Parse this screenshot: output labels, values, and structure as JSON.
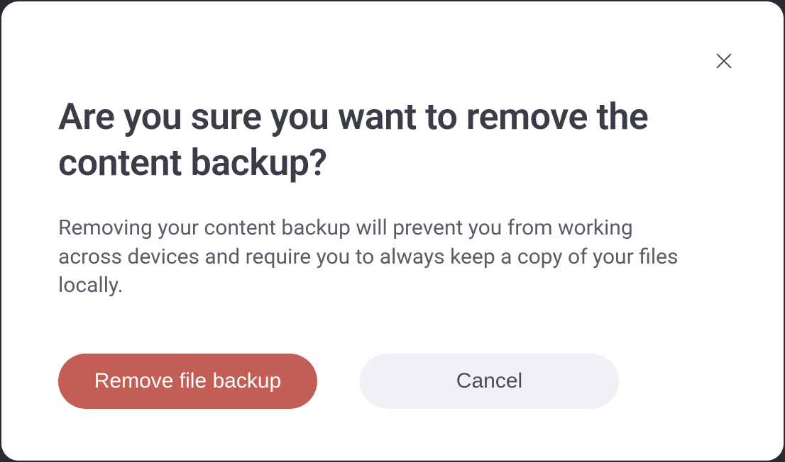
{
  "modal": {
    "title": "Are you sure you want to remove the content backup?",
    "description": "Removing your content backup will prevent you from working across devices and require you to always keep a copy of your files locally.",
    "primary_button_label": "Remove file backup",
    "secondary_button_label": "Cancel"
  }
}
